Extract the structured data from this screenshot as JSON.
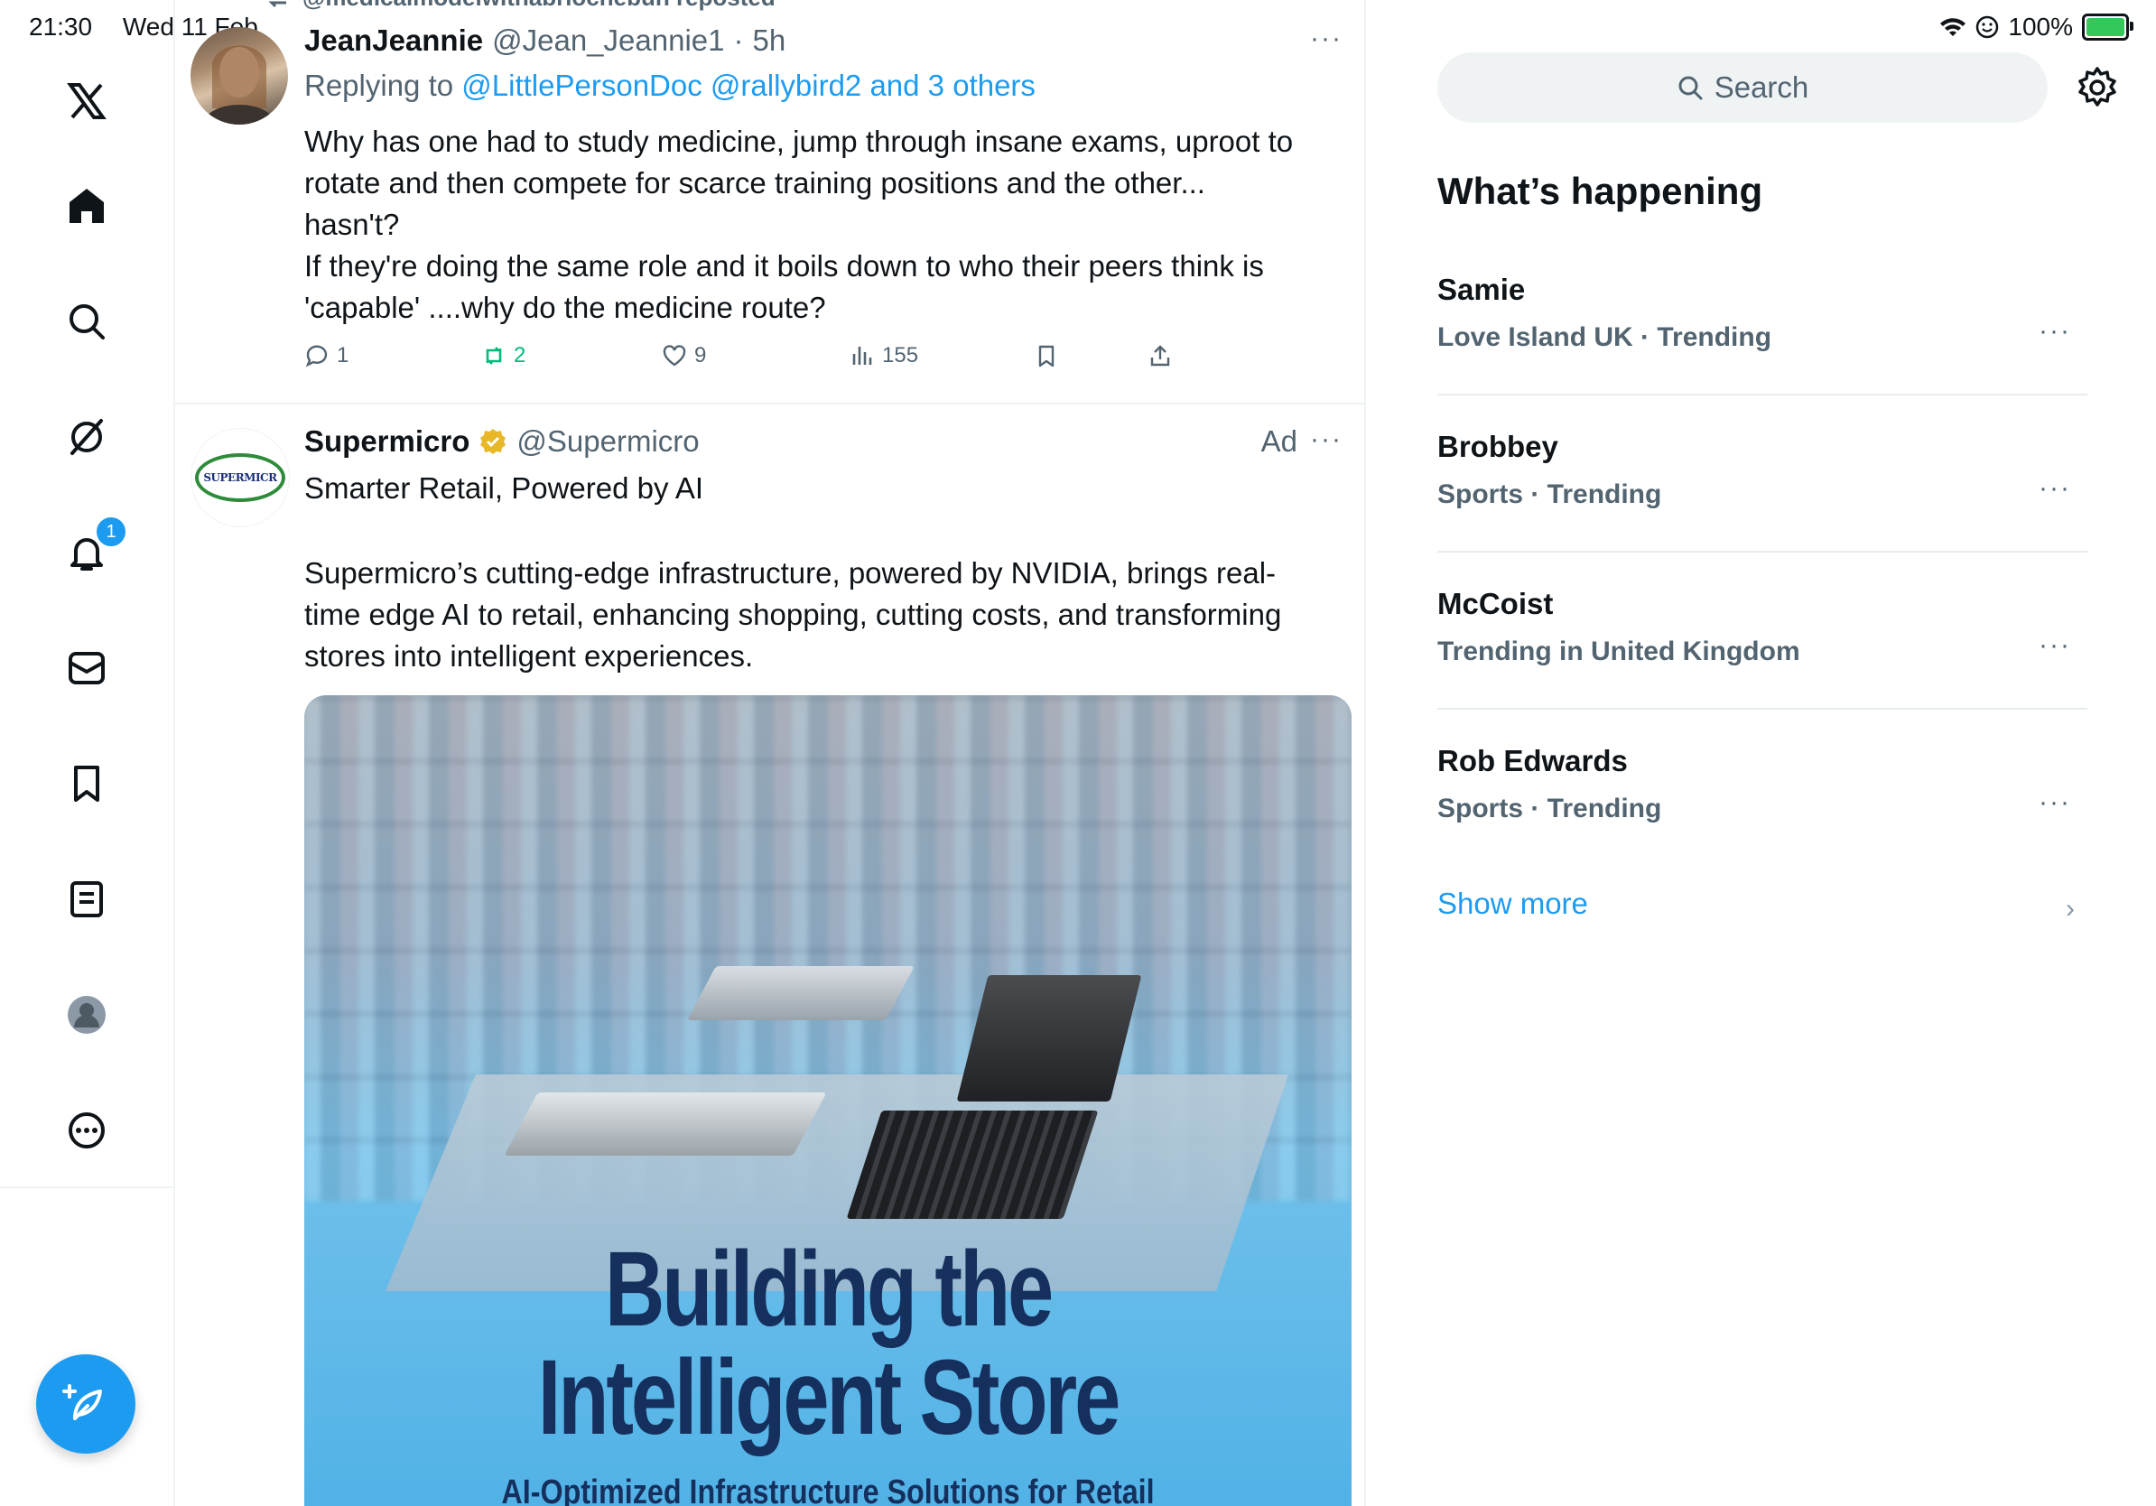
{
  "status_bar": {
    "time": "21:30",
    "date": "Wed 11 Feb",
    "battery": "100%",
    "battery_level": 1.0
  },
  "nav": {
    "items": [
      {
        "name": "x-logo-icon"
      },
      {
        "name": "home-icon"
      },
      {
        "name": "search-icon"
      },
      {
        "name": "grok-icon"
      },
      {
        "name": "notifications-icon",
        "badge": "1"
      },
      {
        "name": "messages-icon"
      },
      {
        "name": "bookmarks-icon"
      },
      {
        "name": "lists-icon"
      },
      {
        "name": "profile-icon"
      },
      {
        "name": "more-icon"
      }
    ],
    "compose_icon": "compose-feather-icon"
  },
  "feed": {
    "repost_banner": "@medicalmodelwithabriochebun reposted",
    "tweet1": {
      "name": "JeanJeannie",
      "handle": "@Jean_Jeannie1",
      "time": "5h",
      "replying_prefix": "Replying to",
      "replying_to": "@LittlePersonDoc @rallybird2 and 3 others",
      "text_lines": [
        "Why has one had to study medicine, jump through insane exams, uproot to",
        "rotate and then compete for scarce training positions and the other...",
        "hasn't?",
        "If they're doing the same role and it boils down to who their peers think is",
        "'capable' ....why do the medicine route?"
      ],
      "replies": "1",
      "reposts": "2",
      "likes": "9",
      "views": "155"
    },
    "tweet2": {
      "name": "Supermicro",
      "handle": "@Supermicro",
      "ad_label": "Ad",
      "logo_text": "SUPERMICR",
      "headline": "Smarter Retail, Powered by AI",
      "body_lines": [
        "Supermicro’s cutting-edge infrastructure, powered by NVIDIA, brings real-",
        "time edge AI to retail, enhancing shopping, cutting costs, and transforming",
        "stores into intelligent experiences."
      ],
      "image_title_1": "Building the",
      "image_title_2": "Intelligent Store",
      "image_subtitle": "AI-Optimized Infrastructure Solutions for Retail"
    }
  },
  "sidebar": {
    "search_placeholder": "Search",
    "section_title": "What’s happening",
    "trends": [
      {
        "name": "Samie",
        "meta": "Love Island UK · Trending"
      },
      {
        "name": "Brobbey",
        "meta": "Sports · Trending"
      },
      {
        "name": "McCoist",
        "meta": "Trending in United Kingdom"
      },
      {
        "name": "Rob Edwards",
        "meta": "Sports · Trending"
      }
    ],
    "show_more": "Show more"
  },
  "colors": {
    "accent": "#1d9bf0",
    "repost_green": "#00ba7c",
    "text": "#0f1419",
    "muted": "#536471"
  }
}
